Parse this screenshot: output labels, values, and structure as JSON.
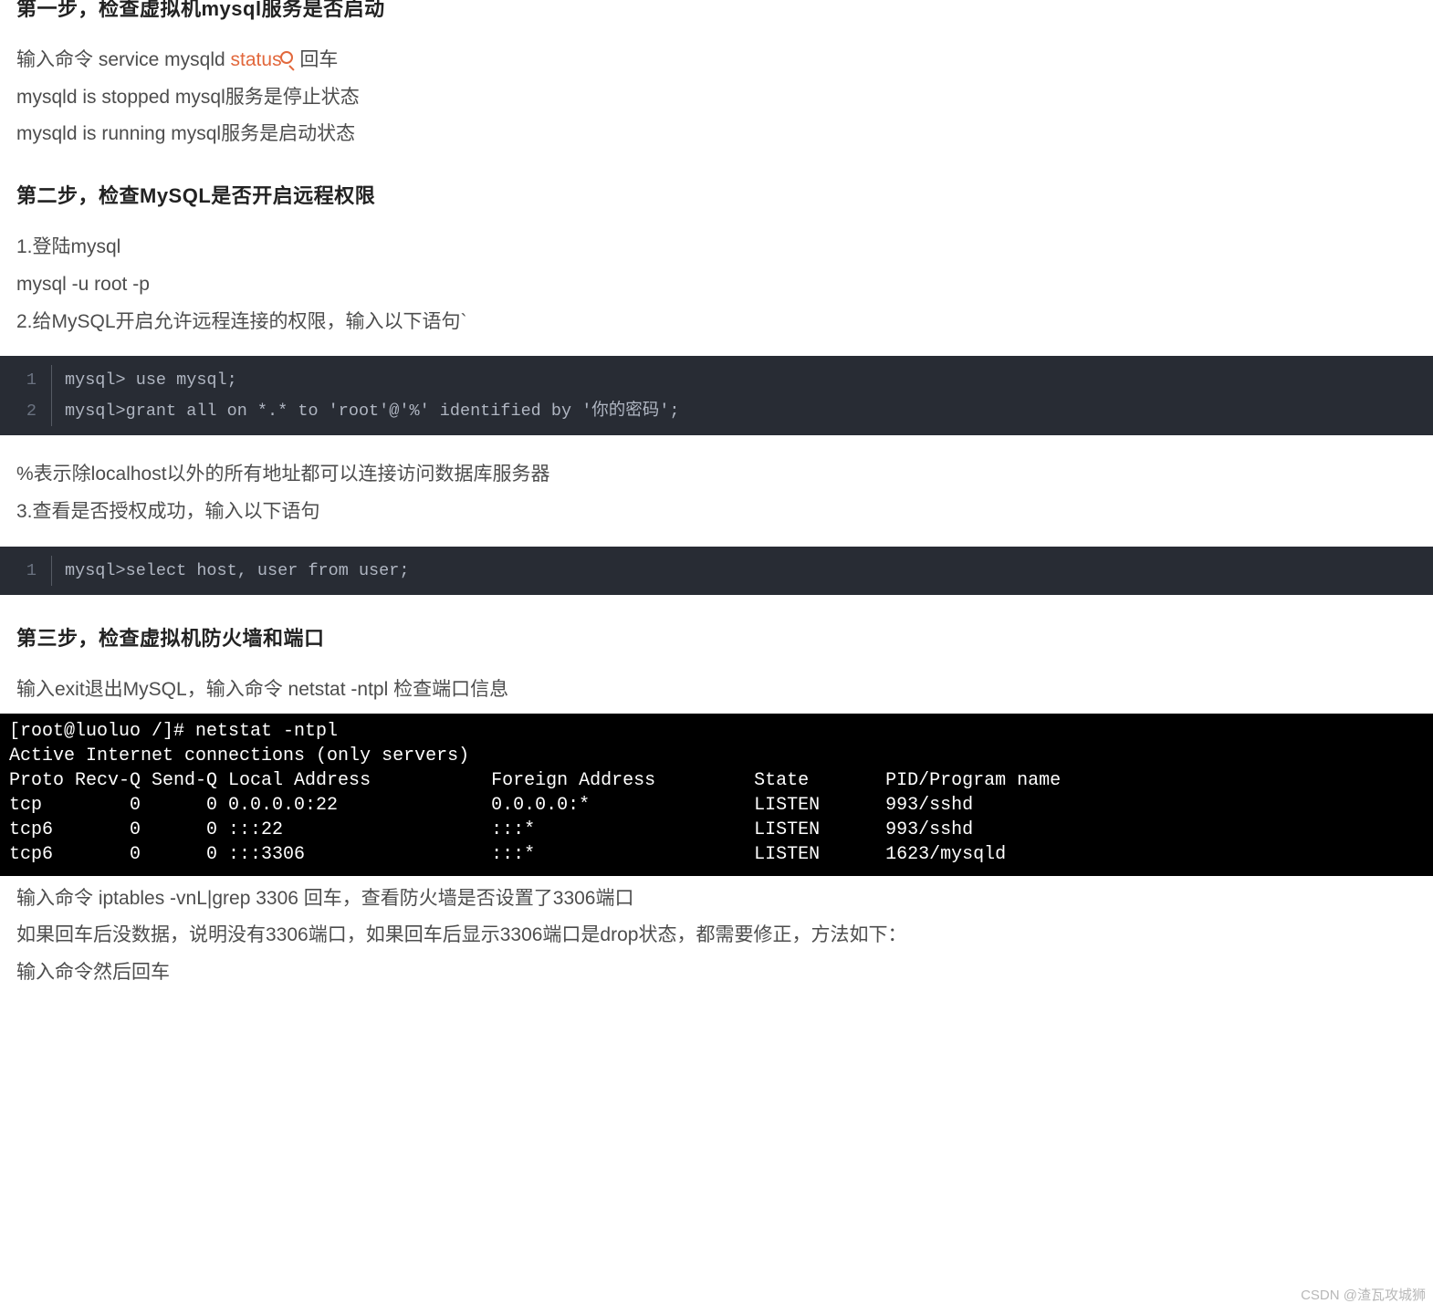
{
  "step1": {
    "title": "第一步，检查虚拟机mysql服务是否启动",
    "line1_pre": "输入命令 service mysqld ",
    "line1_orange": "status",
    "line1_post": " 回车",
    "line2": "mysqld is stopped mysql服务是停止状态",
    "line3": "mysqld is running mysql服务是启动状态"
  },
  "step2": {
    "title": "第二步，检查MySQL是否开启远程权限",
    "p1": "1.登陆mysql",
    "p2": "mysql -u root -p",
    "p3": "2.给MySQL开启允许远程连接的权限，输入以下语句`",
    "code1_lines": [
      "mysql> use mysql;",
      "mysql>grant all on *.* to 'root'@'%' identified by '你的密码';"
    ],
    "p4": "%表示除localhost以外的所有地址都可以连接访问数据库服务器",
    "p5": "3.查看是否授权成功，输入以下语句",
    "code2_lines": [
      "mysql>select host, user from user;"
    ]
  },
  "step3": {
    "title": "第三步，检查虚拟机防火墙和端口",
    "p1": "输入exit退出MySQL，输入命令 netstat -ntpl 检查端口信息",
    "terminal": "[root@luoluo /]# netstat -ntpl\nActive Internet connections (only servers)\nProto Recv-Q Send-Q Local Address           Foreign Address         State       PID/Program name\ntcp        0      0 0.0.0.0:22              0.0.0.0:*               LISTEN      993/sshd\ntcp6       0      0 :::22                   :::*                    LISTEN      993/sshd\ntcp6       0      0 :::3306                 :::*                    LISTEN      1623/mysqld",
    "p2": "输入命令 iptables -vnL|grep 3306 回车，查看防火墙是否设置了3306端口",
    "p3": "如果回车后没数据，说明没有3306端口，如果回车后显示3306端口是drop状态，都需要修正，方法如下：",
    "p4": "输入命令然后回车"
  },
  "watermark": "CSDN @渣瓦攻城狮"
}
